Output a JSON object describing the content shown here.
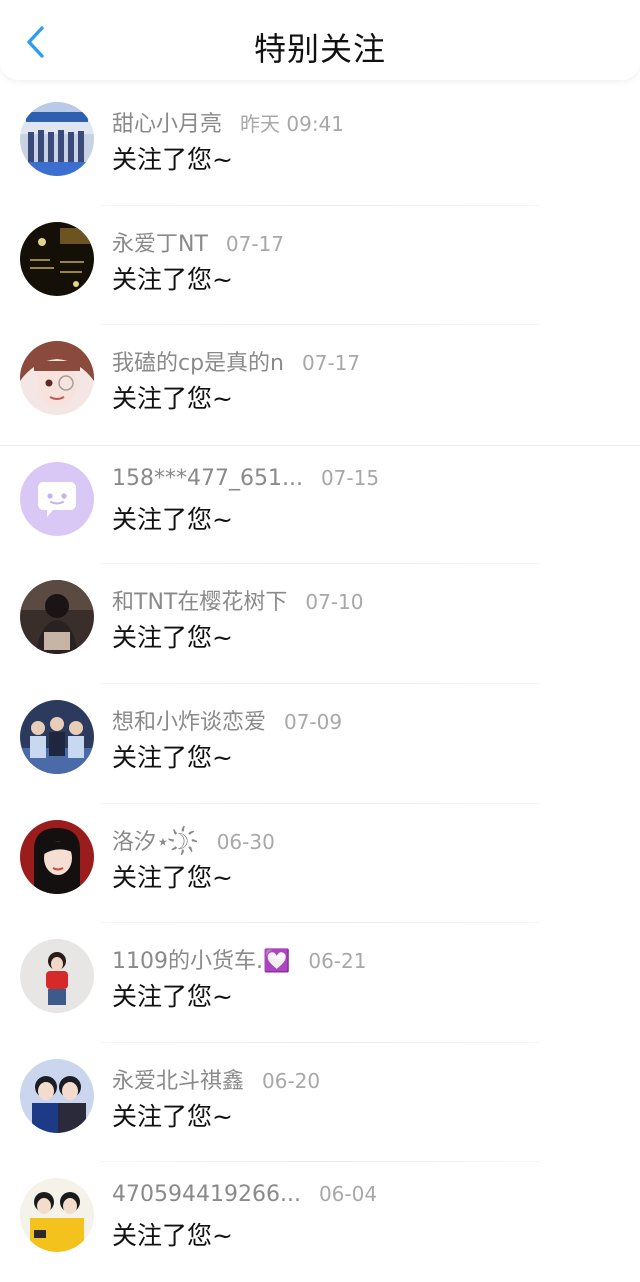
{
  "header": {
    "title": "特别关注",
    "back_icon": "chevron-left-icon"
  },
  "colors": {
    "accent": "#2a9df4",
    "name": "#8a8a8a",
    "time": "#a8a8a8",
    "message": "#111111"
  },
  "items": [
    {
      "name": "甜心小月亮",
      "time": "昨天 09:41",
      "message": "关注了您~"
    },
    {
      "name": "永爱丁NT",
      "time": "07-17",
      "message": "关注了您~"
    },
    {
      "name": "我磕的cp是真的n",
      "time": "07-17",
      "message": "关注了您~"
    },
    {
      "name": "158***477_651...",
      "time": "07-15",
      "message": "关注了您~"
    },
    {
      "name": "和TNT在樱花树下",
      "time": "07-10",
      "message": "关注了您~"
    },
    {
      "name": "想和小炸谈恋爱",
      "time": "07-09",
      "message": "关注了您~"
    },
    {
      "name": "洛汐⋆☽҉",
      "time": "06-30",
      "message": "关注了您~"
    },
    {
      "name": "1109的小货车.💟",
      "time": "06-21",
      "message": "关注了您~"
    },
    {
      "name": "永爱北斗祺鑫",
      "time": "06-20",
      "message": "关注了您~"
    },
    {
      "name": "470594419266...",
      "time": "06-04",
      "message": "关注了您~"
    }
  ]
}
